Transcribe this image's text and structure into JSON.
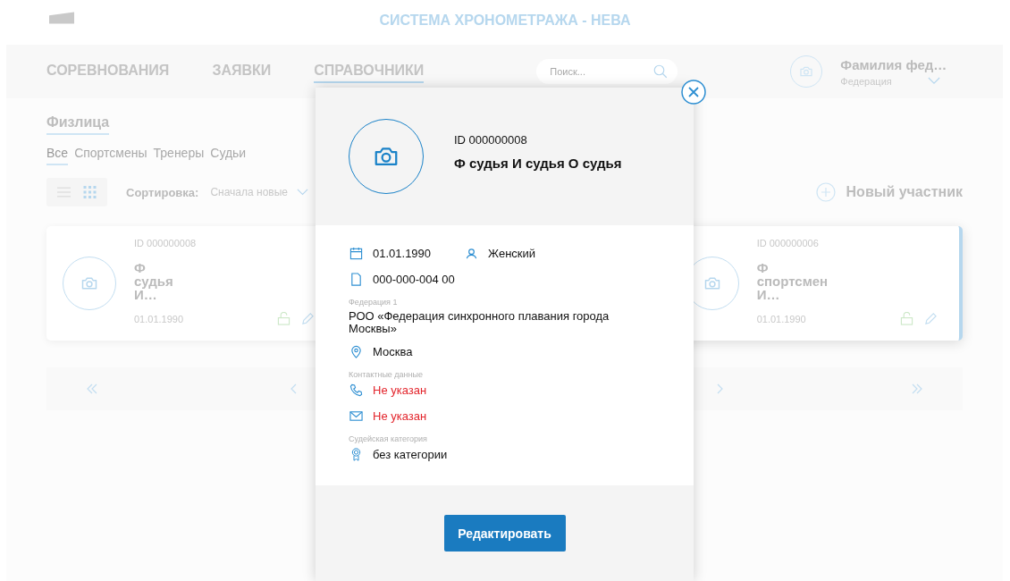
{
  "header": {
    "title": "СИСТЕМА ХРОНОМЕТРАЖА - НЕВА"
  },
  "nav": {
    "tabs": [
      {
        "label": "СОРЕВНОВАНИЯ",
        "selected": false
      },
      {
        "label": "ЗАЯВКИ",
        "selected": false
      },
      {
        "label": "СПРАВОЧНИКИ",
        "selected": true
      }
    ],
    "search": {
      "placeholder": "Поиск..."
    },
    "user": {
      "name": "Фамилия фед…",
      "role": "Федерация"
    }
  },
  "section": {
    "title": "Физлица",
    "filters": [
      {
        "label": "Все",
        "selected": true
      },
      {
        "label": "Спортсмены",
        "selected": false
      },
      {
        "label": "Тренеры",
        "selected": false
      },
      {
        "label": "Судьи",
        "selected": false
      }
    ],
    "view_modes": [
      {
        "kind": "list",
        "selected": false
      },
      {
        "kind": "grid",
        "selected": true
      }
    ],
    "sort": {
      "label": "Сортировка:",
      "value": "Сначала новые"
    },
    "new_button": "Новый участник"
  },
  "cards": [
    {
      "id": "ID 000000008",
      "name": "Ф судья И…",
      "date": "01.01.1990",
      "selected": false
    },
    {
      "id": "ID 000000006",
      "name": "Ф спортсмен И…",
      "date": "01.01.1990",
      "selected": true
    }
  ],
  "modal": {
    "id": "ID 000000008",
    "name": "Ф судья И судья О судья",
    "birth_date": "01.01.1990",
    "gender": "Женский",
    "document": "000-000-004 00",
    "federation_label": "Федерация 1",
    "federation": "РОО «Федерация синхронного плавания города Москвы»",
    "city": "Москва",
    "contacts_label": "Контактные данные",
    "contacts": [
      {
        "kind": "phone",
        "value": "Не указан",
        "missing": true
      },
      {
        "kind": "email",
        "value": "Не указан",
        "missing": true
      }
    ],
    "category_label": "Судейская категория",
    "category": "без категории",
    "edit_button": "Редактировать"
  }
}
